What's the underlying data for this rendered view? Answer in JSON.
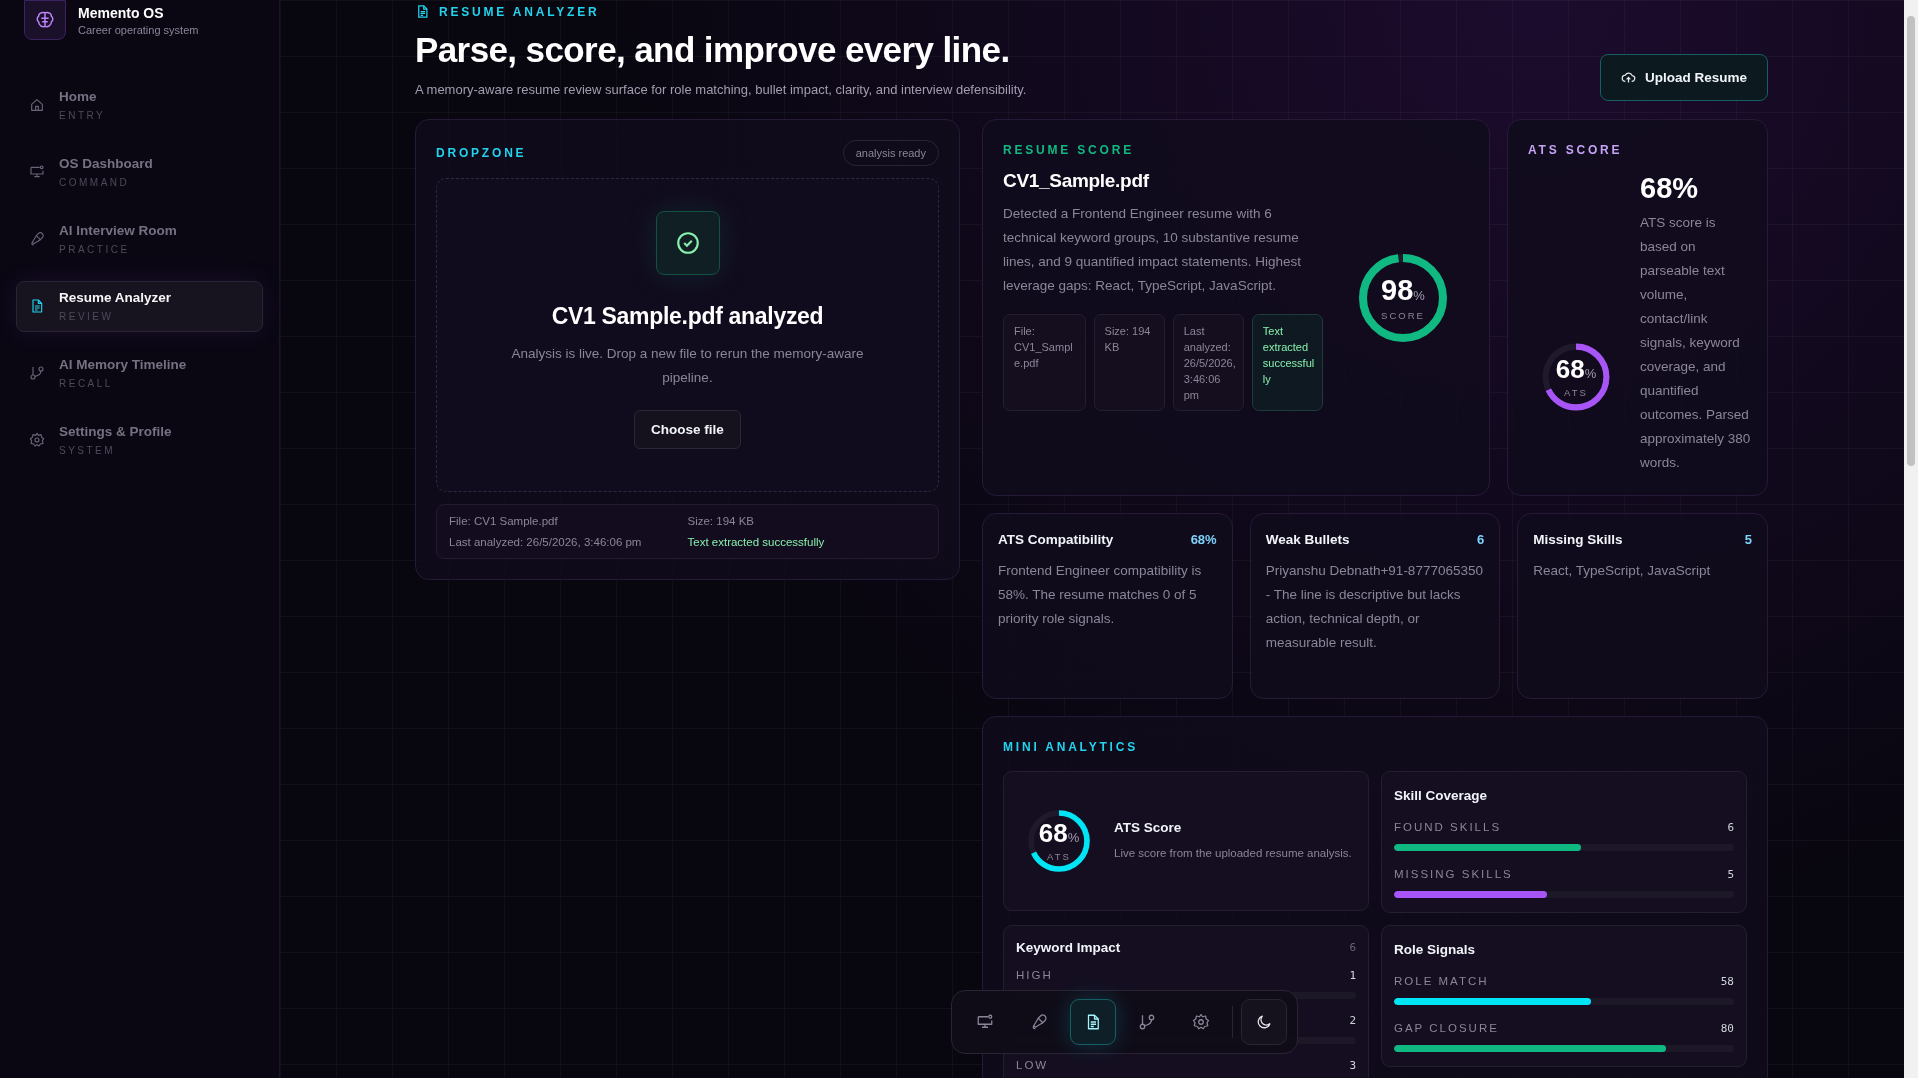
{
  "brand": {
    "name": "Memento OS",
    "tagline": "Career operating system"
  },
  "sidebar": {
    "items": [
      {
        "label": "Home",
        "sub": "ENTRY",
        "selected": false
      },
      {
        "label": "OS Dashboard",
        "sub": "COMMAND",
        "selected": false
      },
      {
        "label": "AI Interview Room",
        "sub": "PRACTICE",
        "selected": false
      },
      {
        "label": "Resume Analyzer",
        "sub": "REVIEW",
        "selected": true
      },
      {
        "label": "AI Memory Timeline",
        "sub": "RECALL",
        "selected": false
      },
      {
        "label": "Settings & Profile",
        "sub": "SYSTEM",
        "selected": false
      }
    ]
  },
  "header": {
    "eyebrow": "RESUME ANALYZER",
    "title": "Parse, score, and improve every line.",
    "subtitle": "A memory-aware resume review surface for role matching, bullet impact, clarity, and interview defensibility.",
    "upload_button": "Upload Resume"
  },
  "dropzone": {
    "title": "DROPZONE",
    "badge": "analysis ready",
    "heading": "CV1 Sample.pdf analyzed",
    "text": "Analysis is live. Drop a new file to rerun the memory-aware pipeline.",
    "button": "Choose file",
    "meta": [
      {
        "text": "File: CV1 Sample.pdf",
        "kind": "plain"
      },
      {
        "text": "Size: 194 KB",
        "kind": "plain"
      },
      {
        "text": "Last analyzed: 26/5/2026, 3:46:06 pm",
        "kind": "plain"
      },
      {
        "text": "Text extracted successfully",
        "kind": "success"
      }
    ]
  },
  "resume_score": {
    "title": "RESUME SCORE",
    "file": "CV1_Sample.pdf",
    "text": "Detected a Frontend Engineer resume with 6 technical keyword groups, 10 substantive resume lines, and 9 quantified impact statements. Highest leverage gaps: React, TypeScript, JavaScript.",
    "chips": [
      {
        "text": "File: CV1_Sample.pdf",
        "kind": "plain"
      },
      {
        "text": "Size: 194 KB",
        "kind": "plain"
      },
      {
        "text": "Last analyzed: 26/5/2026, 3:46:06 pm",
        "kind": "plain"
      },
      {
        "text": "Text extracted successfully",
        "kind": "success"
      }
    ],
    "ring": {
      "value": "98",
      "unit": "%",
      "label": "SCORE",
      "level": 0.98
    }
  },
  "ats_score": {
    "title": "ATS SCORE",
    "value": "68%",
    "text": "ATS score is based on parseable text volume, contact/link signals, keyword coverage, and quantified outcomes. Parsed approximately 380 words.",
    "ring": {
      "value": "68",
      "unit": "%",
      "label": "ATS",
      "level": 0.68
    }
  },
  "cards": [
    {
      "title": "ATS Compatibility",
      "count": "68%",
      "text": "Frontend Engineer compatibility is 58%. The resume matches 0 of 5 priority role signals."
    },
    {
      "title": "Weak Bullets",
      "count": "6",
      "text": "Priyanshu Debnath+91-8777065350 - The line is descriptive but lacks action, technical depth, or measurable result."
    },
    {
      "title": "Missing Skills",
      "count": "5",
      "text": "React, TypeScript, JavaScript"
    }
  ],
  "mini_analytics": {
    "title": "MINI ANALYTICS",
    "ats": {
      "title": "ATS Score",
      "text": "Live score from the uploaded resume analysis.",
      "ring": {
        "value": "68",
        "unit": "%",
        "label": "ATS",
        "level": 0.68
      }
    },
    "skill_coverage": {
      "title": "Skill Coverage",
      "bars": [
        {
          "label": "FOUND SKILLS",
          "value": "6",
          "level": 0.55,
          "color": "#10b981"
        },
        {
          "label": "MISSING SKILLS",
          "value": "5",
          "level": 0.45,
          "color": "#a855f7"
        }
      ]
    },
    "keyword_impact": {
      "title": "Keyword Impact",
      "count": "6",
      "rows": [
        {
          "label": "HIGH",
          "value": "1"
        },
        {
          "value": "2"
        },
        {
          "label": "LOW",
          "value": "3"
        }
      ]
    },
    "role_signals": {
      "title": "Role Signals",
      "bars": [
        {
          "label": "ROLE MATCH",
          "value": "58",
          "level": 0.58,
          "color": "#00e5f5"
        },
        {
          "label": "GAP CLOSURE",
          "value": "80",
          "level": 0.8,
          "color": "#10b981"
        }
      ]
    }
  },
  "dock": {
    "items": [
      {
        "selected": false
      },
      {
        "selected": false
      },
      {
        "selected": true
      },
      {
        "selected": false
      },
      {
        "selected": false
      }
    ]
  }
}
